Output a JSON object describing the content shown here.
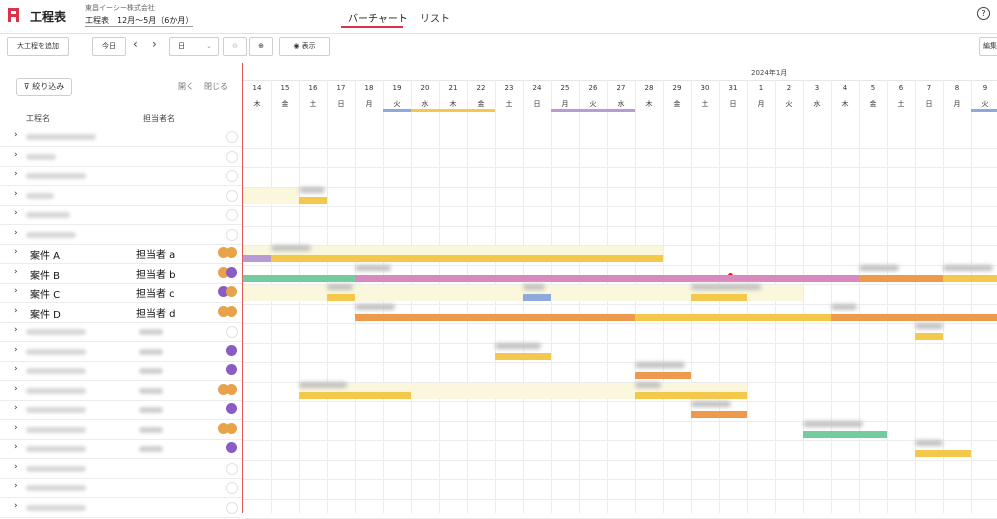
{
  "header": {
    "app_title": "工程表",
    "company": "東昌イーシー株式会社",
    "schedule_title": "工程表　12月～5月（6か月）",
    "tabs": [
      {
        "label": "バーチャート",
        "active": true
      },
      {
        "label": "リスト",
        "active": false
      }
    ],
    "help_icon": "help-circle-icon"
  },
  "toolbar": {
    "add_label": "大工程を追加",
    "today_label": "今日",
    "unit_value": "日",
    "display_label": "表示",
    "edit_label": "編集"
  },
  "left_header": {
    "filter_label": "絞り込み",
    "open_label": "開く",
    "close_label": "閉じる",
    "col_process": "工程名",
    "col_assignee": "担当者名"
  },
  "rows": [
    {
      "name": "",
      "assignee": "",
      "blur": true
    },
    {
      "name": "",
      "assignee": "",
      "blur": true
    },
    {
      "name": "",
      "assignee": "",
      "blur": true
    },
    {
      "name": "",
      "assignee": "",
      "blur": true
    },
    {
      "name": "",
      "assignee": "",
      "blur": true
    },
    {
      "name": "",
      "assignee": "",
      "blur": true
    },
    {
      "name": "案件 A",
      "assignee": "担当者 a",
      "avatars": "double-orange"
    },
    {
      "name": "案件 B",
      "assignee": "担当者 b",
      "avatars": "double-orange-purple"
    },
    {
      "name": "案件 C",
      "assignee": "担当者 c",
      "avatars": "double-purple-orange"
    },
    {
      "name": "案件 D",
      "assignee": "担当者 d",
      "avatars": "double-orange"
    },
    {
      "name": "",
      "assignee": "",
      "blur": true
    },
    {
      "name": "",
      "assignee": "",
      "blur": true,
      "avatars": "purple"
    },
    {
      "name": "",
      "assignee": "",
      "blur": true,
      "avatars": "purple"
    },
    {
      "name": "",
      "assignee": "",
      "blur": true,
      "avatars": "double-orange"
    },
    {
      "name": "",
      "assignee": "",
      "blur": true,
      "avatars": "purple"
    },
    {
      "name": "",
      "assignee": "",
      "blur": true,
      "avatars": "double-orange"
    },
    {
      "name": "",
      "assignee": "",
      "blur": true,
      "avatars": "purple"
    },
    {
      "name": "",
      "assignee": "",
      "blur": true
    },
    {
      "name": "",
      "assignee": "",
      "blur": true
    },
    {
      "name": "",
      "assignee": "",
      "blur": true
    }
  ],
  "calendar": {
    "month_label": "2024年1月",
    "days": [
      "14",
      "15",
      "16",
      "17",
      "18",
      "19",
      "20",
      "21",
      "22",
      "23",
      "24",
      "25",
      "26",
      "27",
      "28",
      "29",
      "30",
      "31",
      "1",
      "2",
      "3",
      "4",
      "5",
      "6",
      "7",
      "8",
      "9"
    ],
    "weekdays": [
      "木",
      "金",
      "土",
      "日",
      "月",
      "火",
      "水",
      "木",
      "金",
      "土",
      "日",
      "月",
      "火",
      "水",
      "木",
      "金",
      "土",
      "日",
      "月",
      "火",
      "水",
      "木",
      "金",
      "土",
      "日",
      "月",
      "火"
    ]
  },
  "colors": {
    "yellow": "#f4c84a",
    "orange": "#ee9a4c",
    "pink": "#d88ac0",
    "green": "#72cc9e",
    "blue": "#8fa9dc",
    "lavender": "#b79ad6",
    "band": "#fbf7dc",
    "accent": "#d9334c"
  }
}
